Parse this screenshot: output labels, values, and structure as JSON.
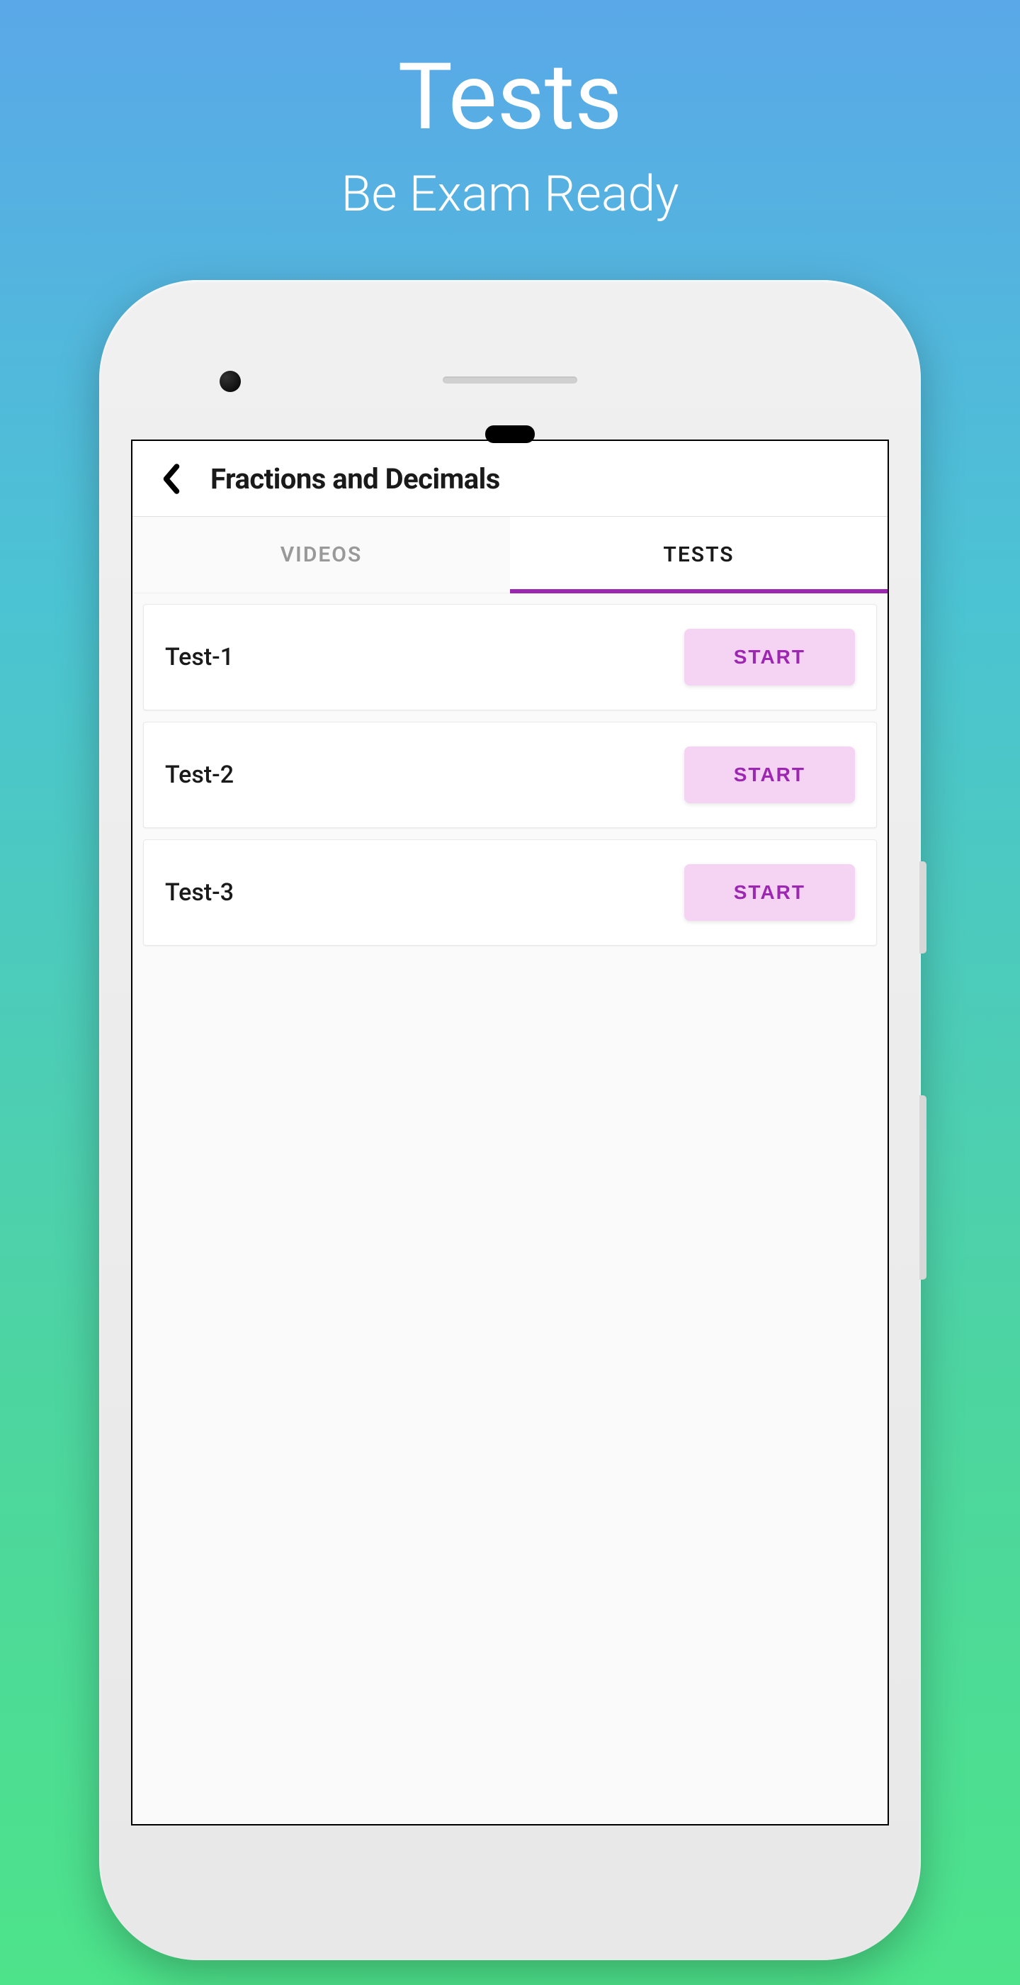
{
  "promo": {
    "title": "Tests",
    "subtitle": "Be Exam Ready"
  },
  "app": {
    "header": {
      "title": "Fractions and Decimals"
    },
    "tabs": {
      "videos": "VIDEOS",
      "tests": "TESTS"
    },
    "tests": [
      {
        "name": "Test-1",
        "action": "START"
      },
      {
        "name": "Test-2",
        "action": "START"
      },
      {
        "name": "Test-3",
        "action": "START"
      }
    ]
  }
}
